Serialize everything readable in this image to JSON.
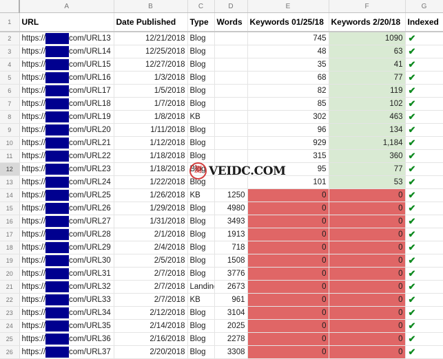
{
  "app": {
    "type": "spreadsheet",
    "colors": {
      "fill_green": "#d9ead3",
      "fill_red": "#e06666",
      "redaction": "#00008f",
      "check_green": "#0d8a1f",
      "header_gray": "#f5f5f5",
      "selected_row_gray": "#d8d8d8"
    }
  },
  "column_letters": [
    "A",
    "B",
    "C",
    "D",
    "E",
    "F",
    "G"
  ],
  "headers": {
    "url": "URL",
    "date_published": "Date Published",
    "type": "Type",
    "words": "Words",
    "keywords_1": "Keywords 01/25/18",
    "keywords_2": "Keywords 2/20/18",
    "indexed": "Indexed"
  },
  "url_parts": {
    "prefix": "https://",
    "redacted": "",
    "suffix_base": "com/"
  },
  "selected_row": 12,
  "check_glyph": "✔",
  "rows": [
    {
      "n": 2,
      "url_suffix": "com/URL13",
      "date": "12/21/2018",
      "type": "Blog",
      "words": "",
      "kw1": "745",
      "kw2": "1090",
      "indexed": "✔",
      "kw1_fill": "none",
      "kw2_fill": "green"
    },
    {
      "n": 3,
      "url_suffix": "com/URL14",
      "date": "12/25/2018",
      "type": "Blog",
      "words": "",
      "kw1": "48",
      "kw2": "63",
      "indexed": "✔",
      "kw1_fill": "none",
      "kw2_fill": "green"
    },
    {
      "n": 4,
      "url_suffix": "com/URL15",
      "date": "12/27/2018",
      "type": "Blog",
      "words": "",
      "kw1": "35",
      "kw2": "41",
      "indexed": "✔",
      "kw1_fill": "none",
      "kw2_fill": "green"
    },
    {
      "n": 5,
      "url_suffix": "com/URL16",
      "date": "1/3/2018",
      "type": "Blog",
      "words": "",
      "kw1": "68",
      "kw2": "77",
      "indexed": "✔",
      "kw1_fill": "none",
      "kw2_fill": "green"
    },
    {
      "n": 6,
      "url_suffix": "com/URL17",
      "date": "1/5/2018",
      "type": "Blog",
      "words": "",
      "kw1": "82",
      "kw2": "119",
      "indexed": "✔",
      "kw1_fill": "none",
      "kw2_fill": "green"
    },
    {
      "n": 7,
      "url_suffix": "com/URL18",
      "date": "1/7/2018",
      "type": "Blog",
      "words": "",
      "kw1": "85",
      "kw2": "102",
      "indexed": "✔",
      "kw1_fill": "none",
      "kw2_fill": "green"
    },
    {
      "n": 8,
      "url_suffix": "com/URL19",
      "date": "1/8/2018",
      "type": "KB",
      "words": "",
      "kw1": "302",
      "kw2": "463",
      "indexed": "✔",
      "kw1_fill": "none",
      "kw2_fill": "green"
    },
    {
      "n": 9,
      "url_suffix": "com/URL20",
      "date": "1/11/2018",
      "type": "Blog",
      "words": "",
      "kw1": "96",
      "kw2": "134",
      "indexed": "✔",
      "kw1_fill": "none",
      "kw2_fill": "green"
    },
    {
      "n": 10,
      "url_suffix": "com/URL21",
      "date": "1/12/2018",
      "type": "Blog",
      "words": "",
      "kw1": "929",
      "kw2": "1,184",
      "indexed": "✔",
      "kw1_fill": "none",
      "kw2_fill": "green"
    },
    {
      "n": 11,
      "url_suffix": "com/URL22",
      "date": "1/18/2018",
      "type": "Blog",
      "words": "",
      "kw1": "315",
      "kw2": "360",
      "indexed": "✔",
      "kw1_fill": "none",
      "kw2_fill": "green"
    },
    {
      "n": 12,
      "url_suffix": "com/URL23",
      "date": "1/18/2018",
      "type": "Blog",
      "words": "",
      "kw1": "95",
      "kw2": "77",
      "indexed": "✔",
      "kw1_fill": "none",
      "kw2_fill": "green"
    },
    {
      "n": 13,
      "url_suffix": "com/URL24",
      "date": "1/22/2018",
      "type": "Blog",
      "words": "",
      "kw1": "101",
      "kw2": "53",
      "indexed": "✔",
      "kw1_fill": "none",
      "kw2_fill": "green"
    },
    {
      "n": 14,
      "url_suffix": "com/URL25",
      "date": "1/26/2018",
      "type": "KB",
      "words": "1250",
      "kw1": "0",
      "kw2": "0",
      "indexed": "✔",
      "kw1_fill": "red",
      "kw2_fill": "red"
    },
    {
      "n": 15,
      "url_suffix": "com/URL26",
      "date": "1/29/2018",
      "type": "Blog",
      "words": "4980",
      "kw1": "0",
      "kw2": "0",
      "indexed": "✔",
      "kw1_fill": "red",
      "kw2_fill": "red"
    },
    {
      "n": 16,
      "url_suffix": "com/URL27",
      "date": "1/31/2018",
      "type": "Blog",
      "words": "3493",
      "kw1": "0",
      "kw2": "0",
      "indexed": "✔",
      "kw1_fill": "red",
      "kw2_fill": "red"
    },
    {
      "n": 17,
      "url_suffix": "com/URL28",
      "date": "2/1/2018",
      "type": "Blog",
      "words": "1913",
      "kw1": "0",
      "kw2": "0",
      "indexed": "✔",
      "kw1_fill": "red",
      "kw2_fill": "red"
    },
    {
      "n": 18,
      "url_suffix": "com/URL29",
      "date": "2/4/2018",
      "type": "Blog",
      "words": "718",
      "kw1": "0",
      "kw2": "0",
      "indexed": "✔",
      "kw1_fill": "red",
      "kw2_fill": "red"
    },
    {
      "n": 19,
      "url_suffix": "com/URL30",
      "date": "2/5/2018",
      "type": "Blog",
      "words": "1508",
      "kw1": "0",
      "kw2": "0",
      "indexed": "✔",
      "kw1_fill": "red",
      "kw2_fill": "red"
    },
    {
      "n": 20,
      "url_suffix": "com/URL31",
      "date": "2/7/2018",
      "type": "Blog",
      "words": "3776",
      "kw1": "0",
      "kw2": "0",
      "indexed": "✔",
      "kw1_fill": "red",
      "kw2_fill": "red"
    },
    {
      "n": 21,
      "url_suffix": "com/URL32",
      "date": "2/7/2018",
      "type": "Landing",
      "words": "2673",
      "kw1": "0",
      "kw2": "0",
      "indexed": "✔",
      "kw1_fill": "red",
      "kw2_fill": "red"
    },
    {
      "n": 22,
      "url_suffix": "com/URL33",
      "date": "2/7/2018",
      "type": "KB",
      "words": "961",
      "kw1": "0",
      "kw2": "0",
      "indexed": "✔",
      "kw1_fill": "red",
      "kw2_fill": "red"
    },
    {
      "n": 23,
      "url_suffix": "com/URL34",
      "date": "2/12/2018",
      "type": "Blog",
      "words": "3104",
      "kw1": "0",
      "kw2": "0",
      "indexed": "✔",
      "kw1_fill": "red",
      "kw2_fill": "red"
    },
    {
      "n": 24,
      "url_suffix": "com/URL35",
      "date": "2/14/2018",
      "type": "Blog",
      "words": "2025",
      "kw1": "0",
      "kw2": "0",
      "indexed": "✔",
      "kw1_fill": "red",
      "kw2_fill": "red"
    },
    {
      "n": 25,
      "url_suffix": "com/URL36",
      "date": "2/16/2018",
      "type": "Blog",
      "words": "2278",
      "kw1": "0",
      "kw2": "0",
      "indexed": "✔",
      "kw1_fill": "red",
      "kw2_fill": "red"
    },
    {
      "n": 26,
      "url_suffix": "com/URL37",
      "date": "2/20/2018",
      "type": "Blog",
      "words": "3308",
      "kw1": "0",
      "kw2": "0",
      "indexed": "✔",
      "kw1_fill": "red",
      "kw2_fill": "red"
    }
  ],
  "watermark": {
    "seal_char": "测",
    "text": "VEIDC.COM"
  }
}
